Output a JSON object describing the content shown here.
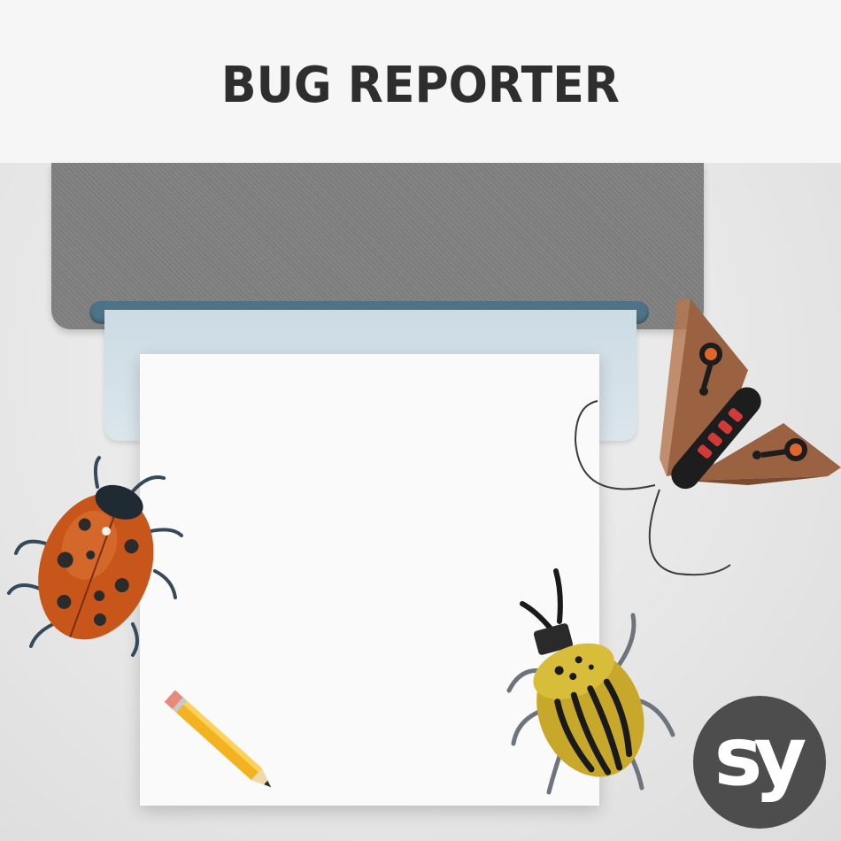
{
  "header": {
    "title": "BUG REPORTER"
  },
  "logo": {
    "text": "sy"
  },
  "colors": {
    "header_bg": "#f6f6f6",
    "printer_body": "#7d7d7d",
    "printer_slot": "#4f7386",
    "back_sheet": "#ccdbe4",
    "paper": "#fafafa",
    "ladybug": "#c8561a",
    "moth_wing": "#9a6240",
    "moth_accent": "#e0652b",
    "beetle": "#c8a82a",
    "pencil": "#f3b21f",
    "logo_bg": "#4d4d4d"
  },
  "icons": [
    "ladybug-icon",
    "moth-icon",
    "beetle-icon",
    "pencil-icon",
    "brand-logo"
  ]
}
